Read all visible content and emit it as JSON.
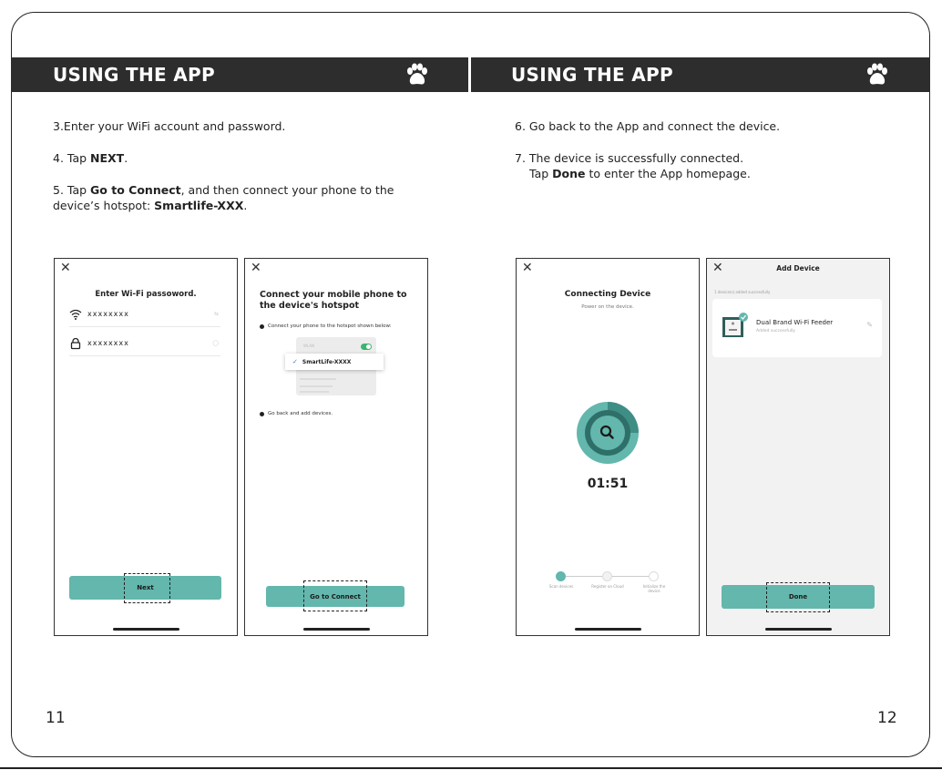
{
  "left_page": {
    "header": "USING THE APP",
    "steps": {
      "s3": "3.Enter your WiFi account and password.",
      "s4_prefix": "4. Tap ",
      "s4_bold": "NEXT",
      "s4_suffix": ".",
      "s5_prefix": "5. Tap ",
      "s5_bold": "Go to Connect",
      "s5_mid": ", and then connect your phone to the device’s hotspot: ",
      "s5_bold2": "Smartlife-XXX",
      "s5_suffix": "."
    },
    "page_number": "11"
  },
  "right_page": {
    "header": "USING THE APP",
    "steps": {
      "s6": "6. Go back to the App and connect the device.",
      "s7_line1": "7. The device is successfully connected.",
      "s7_prefix": "Tap ",
      "s7_bold": "Done",
      "s7_suffix": " to enter the App homepage."
    },
    "page_number": "12"
  },
  "phone1": {
    "close": "✕",
    "title": "Enter Wi-Fi passoword.",
    "wifi_value": "xxxxxxxx",
    "password_value": "xxxxxxxx",
    "button": "Next"
  },
  "phone2": {
    "close": "✕",
    "title": "Connect your mobile phone to the device's hotspot",
    "instruction1": "Connect your phone to the hotspot shown below:",
    "wlan_label": "WLAN",
    "hotspot": "SmartLife-XXXX",
    "instruction2": "Go back and add devices.",
    "button": "Go to Connect"
  },
  "phone3": {
    "close": "✕",
    "title": "Connecting Device",
    "subtitle": "Power on the device.",
    "timer": "01:51",
    "steps": [
      "Scan devices",
      "Register on Cloud",
      "Initialize the device"
    ]
  },
  "phone4": {
    "close": "✕",
    "title": "Add Device",
    "added_count": "1 device(s) added successfully",
    "device_name": "Dual Brand Wi-Fi Feeder",
    "device_status": "Added successfully",
    "button": "Done"
  },
  "colors": {
    "header_bar": "#2d2d2d",
    "teal_accent": "#63b7ac",
    "teal_dark": "#3f8e86"
  }
}
